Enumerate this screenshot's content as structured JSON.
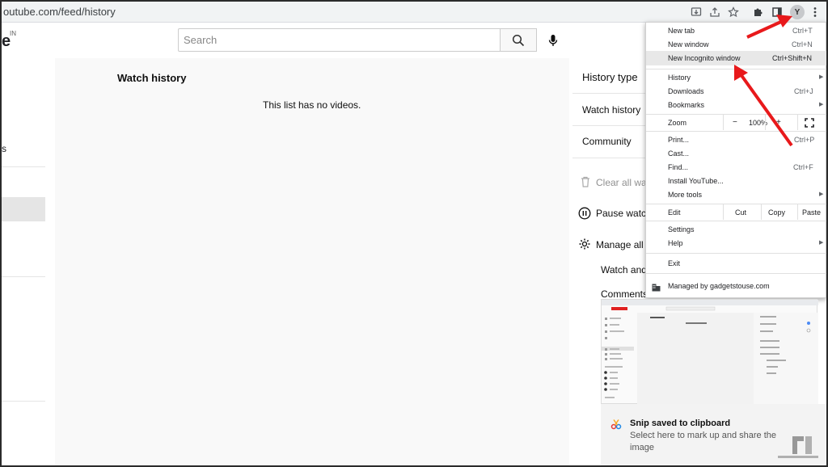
{
  "browser": {
    "url": "outube.com/feed/history"
  },
  "youtube": {
    "logo_text": "e",
    "country_code": "IN",
    "search_placeholder": "Search",
    "sidebar_fragment_text": "s",
    "main": {
      "title": "Watch history",
      "empty_message": "This list has no videos."
    },
    "right_panel": {
      "history_type": "History type",
      "watch_history": "Watch history",
      "community": "Community",
      "clear_all": "Clear all watc",
      "pause": "Pause watch",
      "manage": "Manage all h",
      "watch_and": "Watch and s",
      "comments": "Comments"
    }
  },
  "chrome_menu": {
    "new_tab": {
      "label": "New tab",
      "shortcut": "Ctrl+T"
    },
    "new_window": {
      "label": "New window",
      "shortcut": "Ctrl+N"
    },
    "new_incognito": {
      "label": "New Incognito window",
      "shortcut": "Ctrl+Shift+N"
    },
    "history": {
      "label": "History"
    },
    "downloads": {
      "label": "Downloads",
      "shortcut": "Ctrl+J"
    },
    "bookmarks": {
      "label": "Bookmarks"
    },
    "zoom": {
      "label": "Zoom",
      "minus": "−",
      "value": "100%",
      "plus": "+"
    },
    "print": {
      "label": "Print...",
      "shortcut": "Ctrl+P"
    },
    "cast": {
      "label": "Cast..."
    },
    "find": {
      "label": "Find...",
      "shortcut": "Ctrl+F"
    },
    "install": {
      "label": "Install YouTube..."
    },
    "more_tools": {
      "label": "More tools"
    },
    "edit": {
      "label": "Edit",
      "cut": "Cut",
      "copy": "Copy",
      "paste": "Paste"
    },
    "settings": {
      "label": "Settings"
    },
    "help": {
      "label": "Help"
    },
    "exit": {
      "label": "Exit"
    },
    "managed": {
      "label": "Managed by gadgetstouse.com"
    }
  },
  "snip": {
    "title": "Snip saved to clipboard",
    "message": "Select here to mark up and share the image"
  },
  "colors": {
    "arrow": "#e8191b",
    "menu_highlight": "#e8e8e8"
  }
}
